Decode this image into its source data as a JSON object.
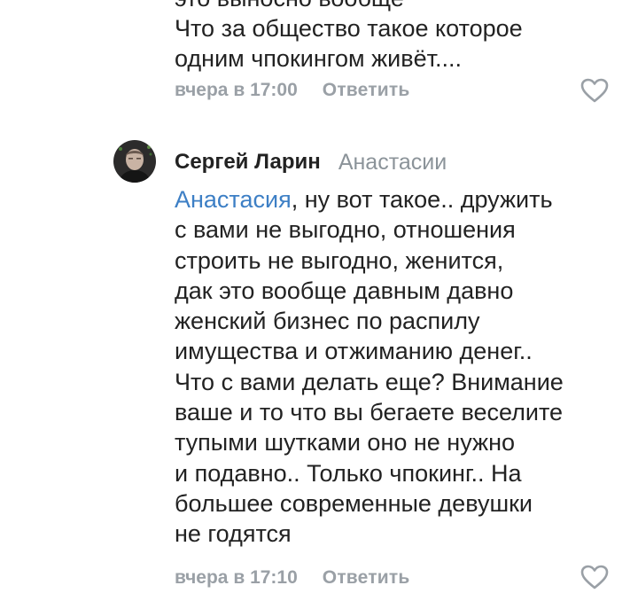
{
  "previous_comment": {
    "text_lines": [
      "это выносно вообще",
      "Что за общество такое которое",
      "одним чпокингом живёт...."
    ],
    "time": "вчера в 17:00",
    "reply_label": "Ответить"
  },
  "comment": {
    "author": "Сергей Ларин",
    "reply_to": "Анастасии",
    "mention": "Анастасия",
    "first_line_rest": ", ну вот такое.. дружить",
    "text_lines": [
      "с вами не выгодно, отношения",
      "строить не выгодно, женится,",
      "дак это вообще давным давно",
      "женский бизнес по распилу",
      "имущества и отжиманию денег..",
      "Что с вами делать еще? Внимание",
      "ваше и то что вы бегаете веселите",
      "тупыми шутками оно не нужно",
      "и подавно.. Только чпокинг.. На",
      "большее современные девушки",
      "не годятся"
    ],
    "time": "вчера в 17:10",
    "reply_label": "Ответить"
  },
  "icons": {
    "like": "heart-outline-icon",
    "avatar": "user-avatar"
  },
  "colors": {
    "text": "#222222",
    "meta": "#9aa0a6",
    "mention": "#3d7fc5",
    "reply_to": "#8b9399",
    "heart": "#9aa0a6"
  }
}
